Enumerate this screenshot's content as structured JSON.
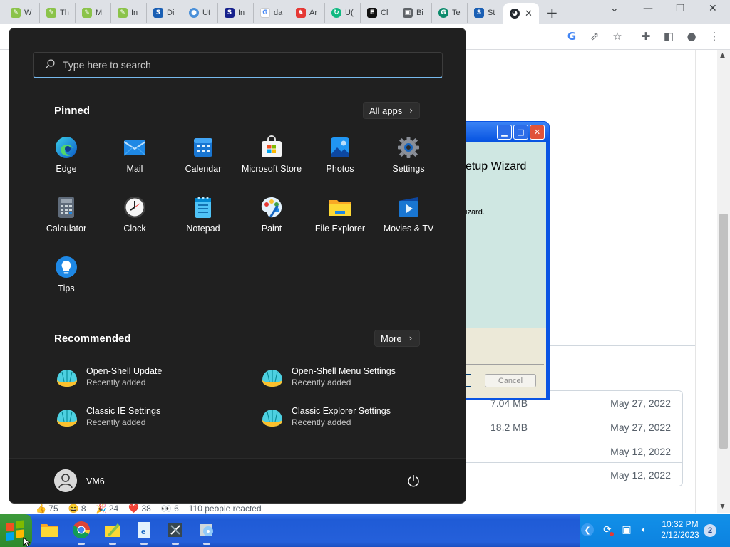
{
  "browser": {
    "tabs": [
      {
        "label": "W"
      },
      {
        "label": "Th"
      },
      {
        "label": "M"
      },
      {
        "label": "In"
      },
      {
        "label": "Di"
      },
      {
        "label": "Ut"
      },
      {
        "label": "In"
      },
      {
        "label": "da"
      },
      {
        "label": "Ar"
      },
      {
        "label": "U("
      },
      {
        "label": "Cl"
      },
      {
        "label": "Bi"
      },
      {
        "label": "Te"
      },
      {
        "label": "St"
      }
    ],
    "new_tab_label": "+",
    "window_controls": {
      "chevron": "⌄",
      "minimize": "—",
      "restore": "❐",
      "close": "✕"
    }
  },
  "start_menu": {
    "search_placeholder": "Type here to search",
    "pinned_title": "Pinned",
    "all_apps_label": "All apps",
    "pinned_apps": [
      {
        "label": "Edge",
        "icon": "edge-icon"
      },
      {
        "label": "Mail",
        "icon": "mail-icon"
      },
      {
        "label": "Calendar",
        "icon": "calendar-icon"
      },
      {
        "label": "Microsoft Store",
        "icon": "store-icon"
      },
      {
        "label": "Photos",
        "icon": "photos-icon"
      },
      {
        "label": "Settings",
        "icon": "gear-icon"
      },
      {
        "label": "Calculator",
        "icon": "calculator-icon"
      },
      {
        "label": "Clock",
        "icon": "clock-icon"
      },
      {
        "label": "Notepad",
        "icon": "notepad-icon"
      },
      {
        "label": "Paint",
        "icon": "paint-icon"
      },
      {
        "label": "File Explorer",
        "icon": "folder-icon"
      },
      {
        "label": "Movies & TV",
        "icon": "movies-icon"
      },
      {
        "label": "Tips",
        "icon": "lightbulb-icon"
      }
    ],
    "recommended_title": "Recommended",
    "more_label": "More",
    "recommended": [
      {
        "title": "Open-Shell Update",
        "subtitle": "Recently added"
      },
      {
        "title": "Open-Shell Menu Settings",
        "subtitle": "Recently added"
      },
      {
        "title": "Classic IE Settings",
        "subtitle": "Recently added"
      },
      {
        "title": "Classic Explorer Settings",
        "subtitle": "Recently added"
      }
    ],
    "user_name": "VM6"
  },
  "background_page": {
    "files": [
      {
        "size": "7.04 MB",
        "date": "May 27, 2022"
      },
      {
        "size": "18.2 MB",
        "date": "May 27, 2022"
      },
      {
        "size": "",
        "date": "May 12, 2022"
      },
      {
        "size": "",
        "date": "May 12, 2022"
      }
    ],
    "reactions": [
      "👍 75",
      "😄 8",
      "🎉 24",
      "❤️ 38",
      "👀 6",
      "110 people reacted"
    ]
  },
  "setup_wizard": {
    "heading": "etup Wizard",
    "text": "izard.",
    "cancel_label": "Cancel"
  },
  "taskbar": {
    "time": "10:32 PM",
    "date": "2/12/2023",
    "notification_count": "2"
  }
}
